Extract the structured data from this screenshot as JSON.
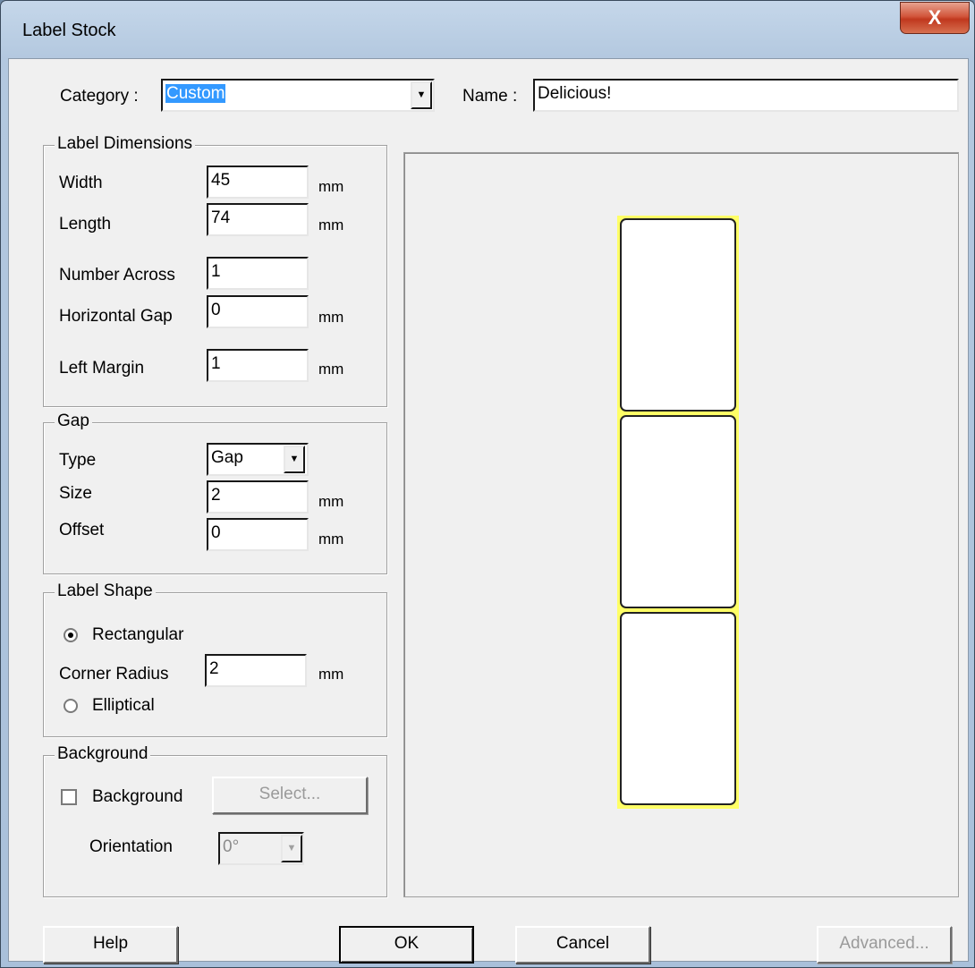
{
  "window": {
    "title": "Label Stock",
    "close_label": "X"
  },
  "category": {
    "label": "Category :",
    "value": "Custom"
  },
  "name": {
    "label": "Name :",
    "value": "Delicious!"
  },
  "label_dimensions": {
    "title": "Label Dimensions",
    "width": {
      "label": "Width",
      "value": "45",
      "unit": "mm"
    },
    "length": {
      "label": "Length",
      "value": "74",
      "unit": "mm"
    },
    "number_across": {
      "label": "Number Across",
      "value": "1"
    },
    "horizontal_gap": {
      "label": "Horizontal Gap",
      "value": "0",
      "unit": "mm"
    },
    "left_margin": {
      "label": "Left Margin",
      "value": "1",
      "unit": "mm"
    }
  },
  "gap": {
    "title": "Gap",
    "type": {
      "label": "Type",
      "value": "Gap"
    },
    "size": {
      "label": "Size",
      "value": "2",
      "unit": "mm"
    },
    "offset": {
      "label": "Offset",
      "value": "0",
      "unit": "mm"
    }
  },
  "label_shape": {
    "title": "Label Shape",
    "rectangular": {
      "label": "Rectangular",
      "selected": true
    },
    "corner_radius": {
      "label": "Corner Radius",
      "value": "2",
      "unit": "mm"
    },
    "elliptical": {
      "label": "Elliptical",
      "selected": false
    }
  },
  "background": {
    "title": "Background",
    "checkbox": {
      "label": "Background",
      "checked": false
    },
    "select_label": "Select...",
    "orientation": {
      "label": "Orientation",
      "value": "0°"
    }
  },
  "preview": {
    "label_count": 3,
    "liner_color": "#ffff66"
  },
  "buttons": {
    "help": "Help",
    "ok": "OK",
    "cancel": "Cancel",
    "advanced": "Advanced..."
  }
}
